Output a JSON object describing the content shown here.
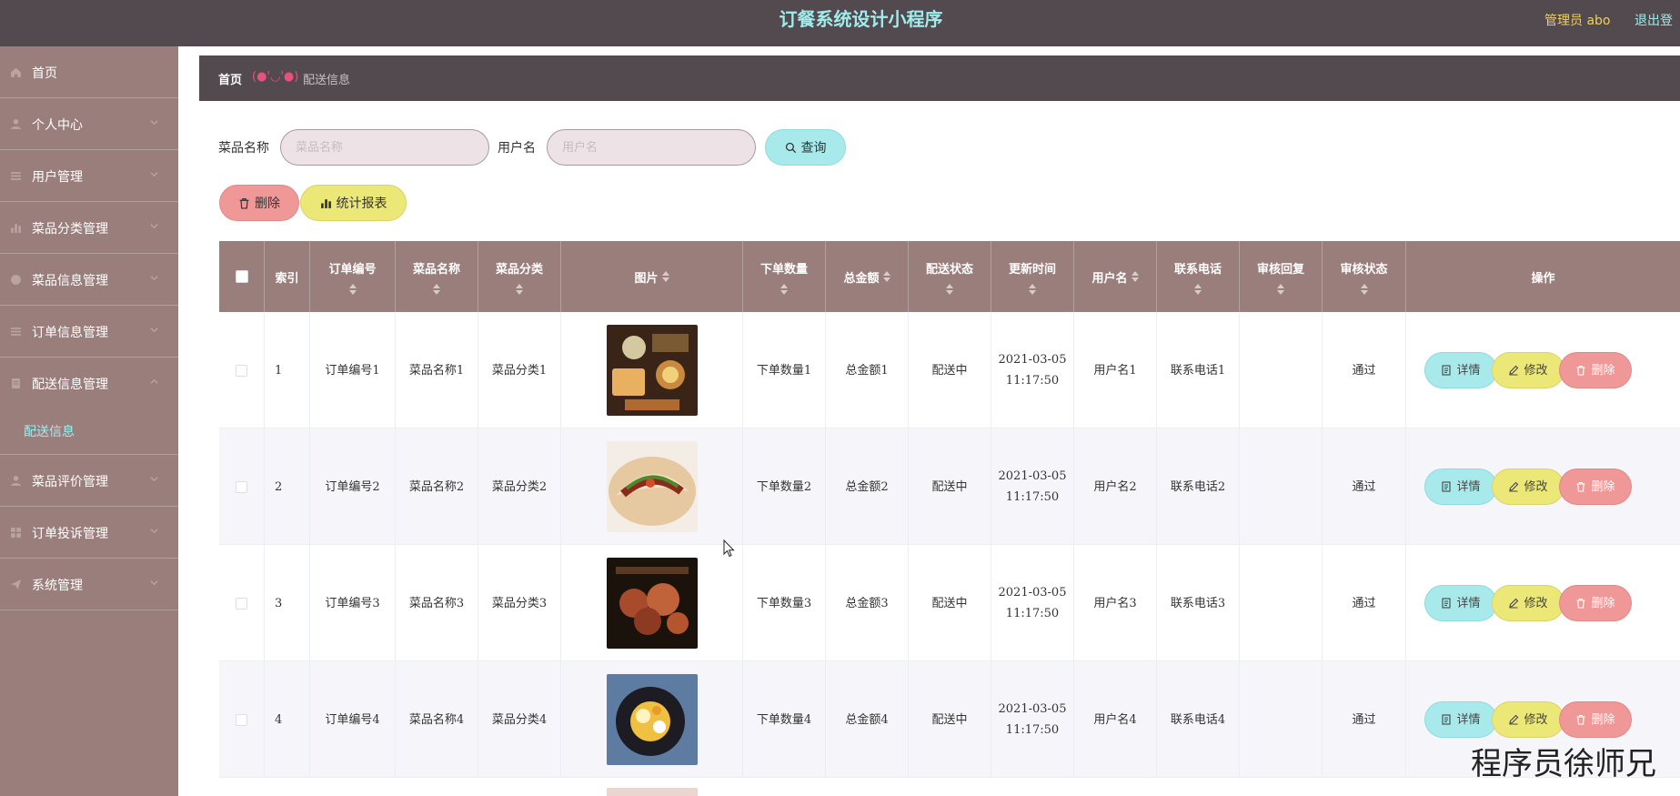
{
  "header": {
    "title": "订餐系统设计小程序",
    "user": "管理员 abo",
    "logout": "退出登"
  },
  "sidebar": {
    "items": [
      {
        "label": "首页",
        "icon": "home-icon"
      },
      {
        "label": "个人中心",
        "icon": "user-icon"
      },
      {
        "label": "用户管理",
        "icon": "list-icon"
      },
      {
        "label": "菜品分类管理",
        "icon": "bar-chart-icon"
      },
      {
        "label": "菜品信息管理",
        "icon": "circle-icon"
      },
      {
        "label": "订单信息管理",
        "icon": "list-icon"
      },
      {
        "label": "配送信息管理",
        "icon": "document-icon"
      },
      {
        "label": "菜品评价管理",
        "icon": "user-icon"
      },
      {
        "label": "订单投诉管理",
        "icon": "grid-icon"
      },
      {
        "label": "系统管理",
        "icon": "send-icon"
      }
    ],
    "active_sub": "配送信息"
  },
  "breadcrumb": {
    "home": "首页",
    "emoji": "(●'◡'●)",
    "current": "配送信息"
  },
  "search": {
    "dish_label": "菜品名称",
    "dish_placeholder": "菜品名称",
    "user_label": "用户名",
    "user_placeholder": "用户名",
    "query_button": "查询"
  },
  "toolbar": {
    "delete_button": "删除",
    "report_button": "统计报表"
  },
  "table": {
    "columns": [
      "索引",
      "订单编号",
      "菜品名称",
      "菜品分类",
      "图片",
      "下单数量",
      "总金额",
      "配送状态",
      "更新时间",
      "用户名",
      "联系电话",
      "审核回复",
      "审核状态",
      "操作"
    ],
    "rows": [
      {
        "index": "1",
        "order_no": "订单编号1",
        "dish": "菜品名称1",
        "category": "菜品分类1",
        "qty": "下单数量1",
        "total": "总金额1",
        "status": "配送中",
        "date": "2021-03-05",
        "time": "11:17:50",
        "user": "用户名1",
        "phone": "联系电话1",
        "reply": "",
        "audit": "通过"
      },
      {
        "index": "2",
        "order_no": "订单编号2",
        "dish": "菜品名称2",
        "category": "菜品分类2",
        "qty": "下单数量2",
        "total": "总金额2",
        "status": "配送中",
        "date": "2021-03-05",
        "time": "11:17:50",
        "user": "用户名2",
        "phone": "联系电话2",
        "reply": "",
        "audit": "通过"
      },
      {
        "index": "3",
        "order_no": "订单编号3",
        "dish": "菜品名称3",
        "category": "菜品分类3",
        "qty": "下单数量3",
        "total": "总金额3",
        "status": "配送中",
        "date": "2021-03-05",
        "time": "11:17:50",
        "user": "用户名3",
        "phone": "联系电话3",
        "reply": "",
        "audit": "通过"
      },
      {
        "index": "4",
        "order_no": "订单编号4",
        "dish": "菜品名称4",
        "category": "菜品分类4",
        "qty": "下单数量4",
        "total": "总金额4",
        "status": "配送中",
        "date": "2021-03-05",
        "time": "11:17:50",
        "user": "用户名4",
        "phone": "联系电话4",
        "reply": "",
        "audit": "通过"
      }
    ],
    "actions": {
      "detail": "详情",
      "edit": "修改",
      "delete": "删除"
    }
  },
  "watermark": "程序员徐师兄",
  "colors": {
    "topbar": "#524a4f",
    "sidebar": "#9a7e7c",
    "accent": "#a0ecec",
    "detail": "#a8eaec",
    "edit": "#ece878",
    "delete": "#f09898"
  }
}
